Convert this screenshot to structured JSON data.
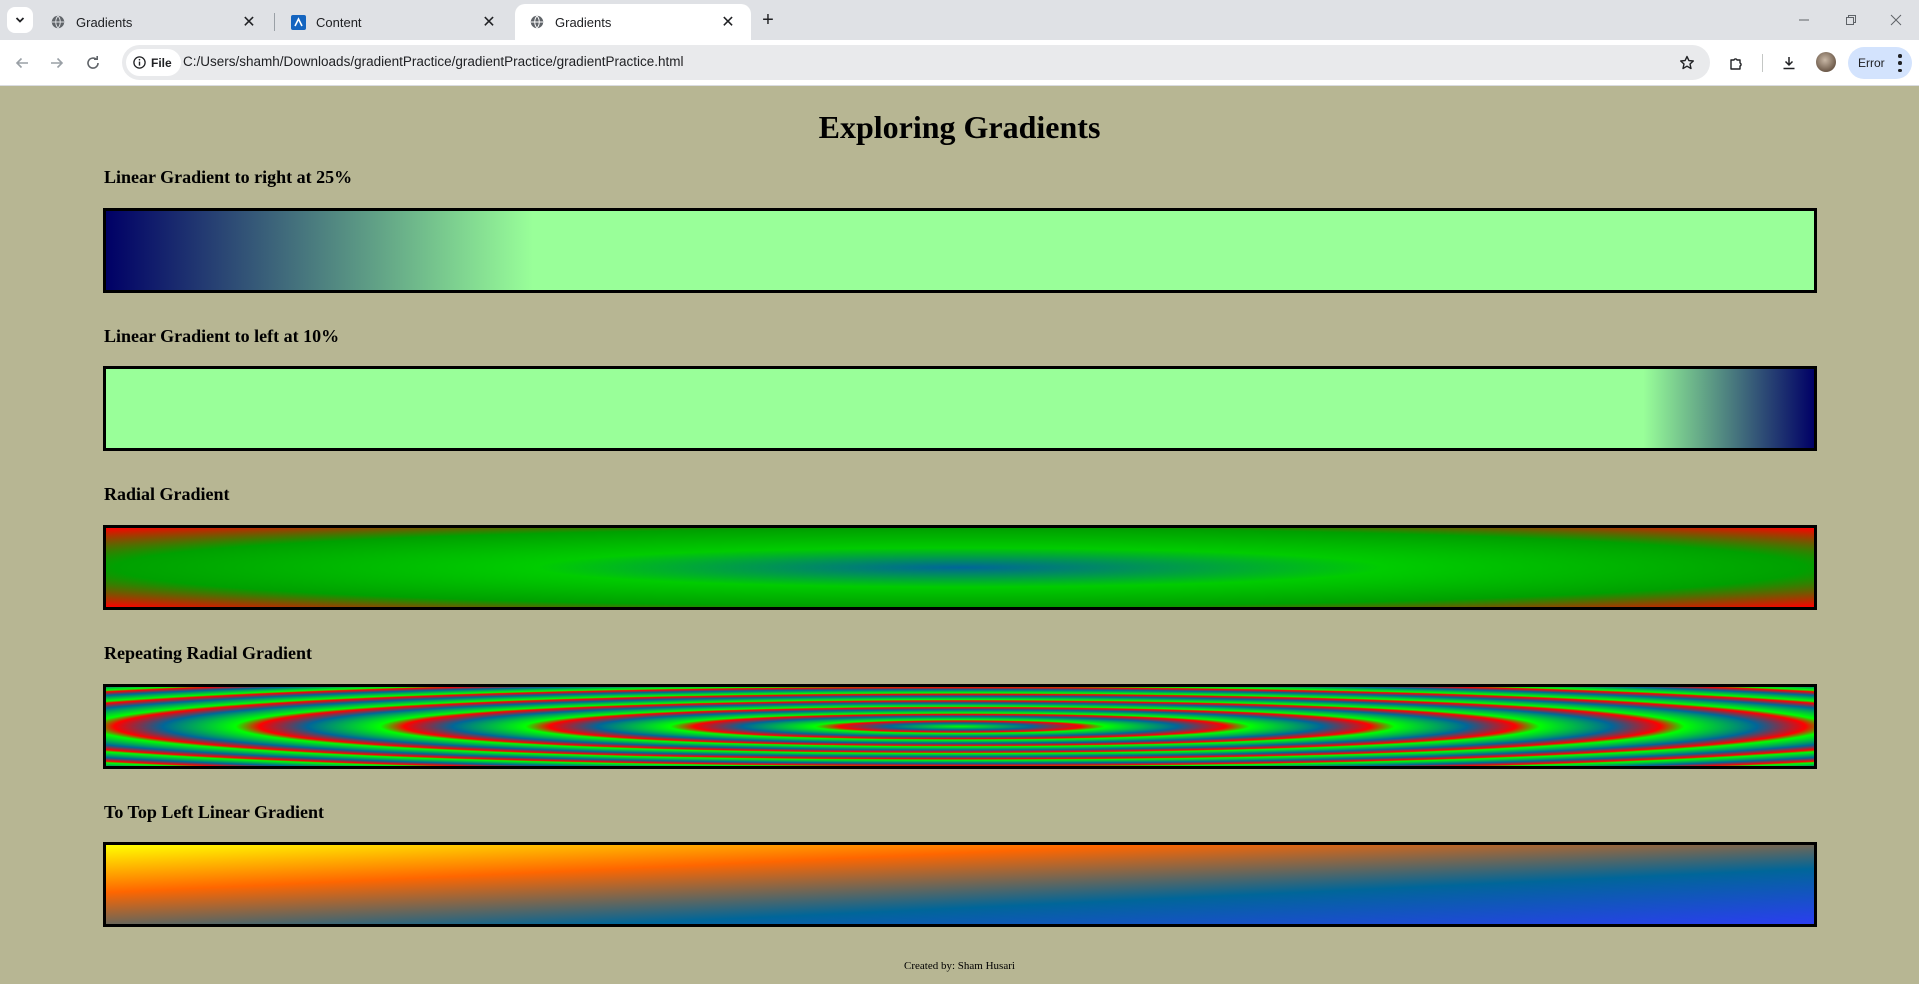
{
  "browser": {
    "tabs": [
      {
        "title": "Gradients",
        "active": false,
        "icon": "globe-icon"
      },
      {
        "title": "Content",
        "active": false,
        "icon": "canvas-logo-icon"
      },
      {
        "title": "Gradients",
        "active": true,
        "icon": "globe-icon"
      }
    ],
    "address": {
      "chip_label": "File",
      "url": "C:/Users/shamh/Downloads/gradientPractice/gradientPractice/gradientPractice.html"
    },
    "profile_status": "Error"
  },
  "page": {
    "title": "Exploring Gradients",
    "sections": [
      {
        "label": "Linear Gradient to right at 25%"
      },
      {
        "label": "Linear Gradient to left at 10%"
      },
      {
        "label": "Radial Gradient"
      },
      {
        "label": "Repeating Radial Gradient"
      },
      {
        "label": "To Top Left Linear Gradient"
      }
    ],
    "footer": "Created by: Sham Husari"
  },
  "colors": {
    "page_background": "#b7b693",
    "navy": "#000066",
    "light_green": "#99ff99",
    "green": "#00cc00",
    "red": "#ff0000",
    "teal_blue": "#006699",
    "blue": "#2b3ef0",
    "orange": "#ff6600",
    "yellow": "#ffff00"
  }
}
